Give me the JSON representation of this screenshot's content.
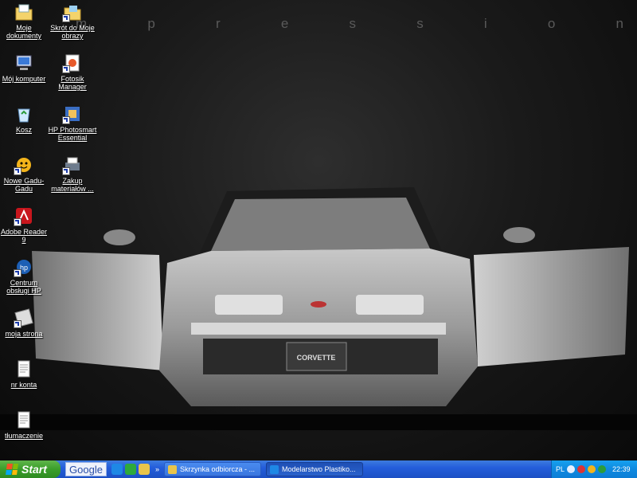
{
  "wallpaper": {
    "letters": [
      "m",
      "p",
      "r",
      "e",
      "s",
      "s",
      "i",
      "o",
      "n"
    ]
  },
  "desktop_icons": [
    {
      "label": "Moje dokumenty",
      "icon": "my-documents-icon"
    },
    {
      "label": "Skrót do Moje obrazy",
      "icon": "my-pictures-folder-icon"
    },
    {
      "label": "Mój komputer",
      "icon": "my-computer-icon"
    },
    {
      "label": "Fotosik Manager",
      "icon": "fotosik-icon"
    },
    {
      "label": "Kosz",
      "icon": "recycle-bin-icon"
    },
    {
      "label": "HP Photosmart Essential",
      "icon": "hp-photosmart-icon"
    },
    {
      "label": "Nowe Gadu-Gadu",
      "icon": "gadu-gadu-icon"
    },
    {
      "label": "Zakup materiałów ...",
      "icon": "printer-supplies-icon"
    },
    {
      "label": "Adobe Reader 9",
      "icon": "adobe-reader-icon"
    },
    {
      "label": "Centrum obsługi HP",
      "icon": "hp-solution-center-icon"
    },
    {
      "label": "moja strona",
      "icon": "web-shortcut-icon"
    },
    {
      "label": "nr konta",
      "icon": "text-document-icon"
    },
    {
      "label": "tłumaczenie",
      "icon": "text-document-icon"
    }
  ],
  "taskbar": {
    "start_label": "Start",
    "google_label": "Google",
    "quick_launch": [
      "ie-icon",
      "messenger-icon",
      "outlook-icon"
    ],
    "overflow": "»",
    "tasks": [
      {
        "label": "Skrzynka odbiorcza - ...",
        "icon": "outlook-icon"
      },
      {
        "label": "Modelarstwo Plastiko...",
        "icon": "ie-icon"
      }
    ]
  },
  "tray": {
    "language": "PL",
    "time": "22:39",
    "icons": [
      "help-icon",
      "security-icon",
      "gadu-icon",
      "network-icon"
    ]
  }
}
